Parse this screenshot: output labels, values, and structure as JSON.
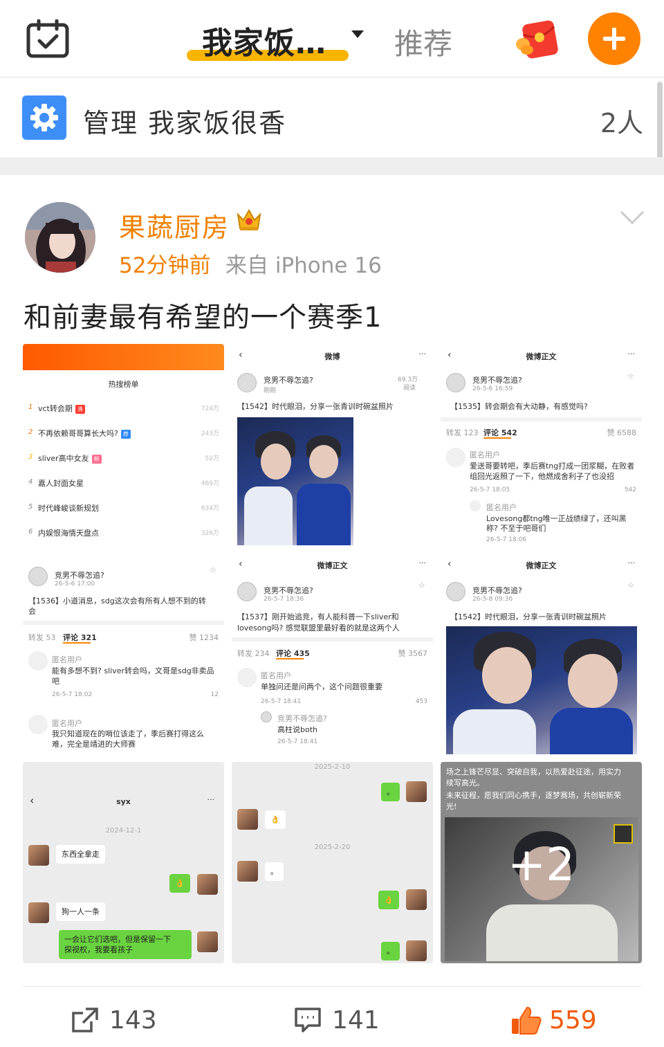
{
  "header": {
    "active_tab": "我家饭…",
    "other_tab": "推荐",
    "icons": [
      "calendar-check-icon",
      "red-packet-icon",
      "add-icon"
    ],
    "colors": {
      "accent": "#ff8200",
      "tab_underline": "#f7b400"
    }
  },
  "group_bar": {
    "label": "管理 我家饭很香",
    "member_count": "2人",
    "icon": "gear-icon"
  },
  "post": {
    "author": "果蔬厨房",
    "time": "52分钟前",
    "source": "来自 iPhone 16",
    "text": "和前妻最有希望的一个赛季1",
    "images": {
      "hot_list": {
        "title": "热搜榜单",
        "rows": [
          {
            "rank": "1",
            "text": "vct转会期",
            "badge": "沸",
            "count": "724万"
          },
          {
            "rank": "2",
            "text": "不再依赖哥哥算长大吗?",
            "badge": "荐",
            "count": "243万"
          },
          {
            "rank": "3",
            "text": "sliver高中女友",
            "badge": "新",
            "count": "52万"
          },
          {
            "rank": "4",
            "text": "嘉人封面女星",
            "badge": "",
            "count": "469万"
          },
          {
            "rank": "5",
            "text": "时代峰峻谈新规划",
            "badge": "",
            "count": "634万"
          },
          {
            "rank": "6",
            "text": "内娱恨海情天盘点",
            "badge": "",
            "count": "326万"
          }
        ]
      },
      "weibo_1542": {
        "title": "微博",
        "user": "竞男不辱怎追?",
        "time": "刚刚",
        "views": "69.3万",
        "views_label": "阅读",
        "text": "【1542】时代眼泪，分享一张青训时碗盆照片"
      },
      "weibo_1535": {
        "title": "微博正文",
        "user": "竞男不辱怎追?",
        "time": "26-5-6 16:59",
        "text": "【1535】转会期会有大动静，有感觉吗?",
        "reposts": "转发 123",
        "comments": "评论 542",
        "likes": "赞 6588",
        "c1_user": "匿名用户",
        "c1_text_a": "爱送哥要转吧，季后赛tng打成一团浆糊，在败者",
        "c1_text_b": "组回光返照了一下，他燃成舍利子了也没招",
        "c1_time": "26-5-7 18:05",
        "c1_likes": "542",
        "c2_user": "匿名用户",
        "c2_text_a": "Lovesong都tng唯一正战绩绿了，还叫黑",
        "c2_text_b": "称? 不至于吧哥们",
        "c2_time": "26-5-7 18:06"
      },
      "weibo_1536": {
        "user": "竞男不辱怎追?",
        "time": "26-5-6 17:00",
        "text_a": "【1536】小道消息，sdg这次会有所有人想不到的转",
        "text_b": "会",
        "reposts": "转发 53",
        "comments": "评论 321",
        "likes": "赞 1234",
        "c1_user": "匿名用户",
        "c1_text_a": "能有多想不到? sliver转会吗，文哥是sdg非卖品",
        "c1_text_b": "吧",
        "c1_time": "26-5-7 18:02",
        "c1_likes": "12",
        "c2_user": "匿名用户",
        "c2_text_a": "我只知道现在的哨位该走了，季后赛打得这么",
        "c2_text_b": "难，完全是靖进的大师赛"
      },
      "weibo_1537": {
        "title": "微博正文",
        "user": "竞男不辱怎追?",
        "time": "26-5-7 18:36",
        "text_a": "【1537】刚开始追竞，有人能科普一下sliver和",
        "text_b": "lovesong吗? 感觉联盟里最好看的就是这两个人",
        "reposts": "转发 234",
        "comments": "评论 435",
        "likes": "赞 3567",
        "c1_user": "匿名用户",
        "c1_text": "单独问还是问两个，这个问题很重要",
        "c1_time": "26-5-7 18:41",
        "c1_likes": "453",
        "c2_user": "竞男不辱怎追?",
        "c2_text": "高柱说both",
        "c2_time": "26-5-7 18:41"
      },
      "weibo_1542_b": {
        "title": "微博正文",
        "user": "竞男不辱怎追?",
        "time": "26-5-8 09:36",
        "text": "【1542】时代眼泪，分享一张青训时碗盆照片"
      },
      "chat_syx": {
        "title": "syx",
        "date": "2024-12-1",
        "m1": "东西全拿走",
        "m2": "👌",
        "m3": "狗一人一条",
        "m4_a": "一会让它们选吧，但是保留一下",
        "m4_b": "探视权，我要看孩子"
      },
      "chat_2": {
        "date1": "2025-2-10",
        "date2": "2025-2-20",
        "m1": "。",
        "m2": "👌",
        "m3": "。",
        "m4": "👌",
        "m5": "。"
      },
      "promo": {
        "text_a": "场之上锋芒尽显、突破自我，以热爱赴征途，用实力",
        "text_b": "续写高光。",
        "text_c": "未来征程，愿我们同心携手，逐梦赛场，共创崭新荣",
        "text_d": "光!",
        "more": "+2"
      }
    },
    "actions": {
      "shares": "143",
      "comments": "141",
      "likes": "559",
      "like_color": "#f05a0a"
    }
  }
}
